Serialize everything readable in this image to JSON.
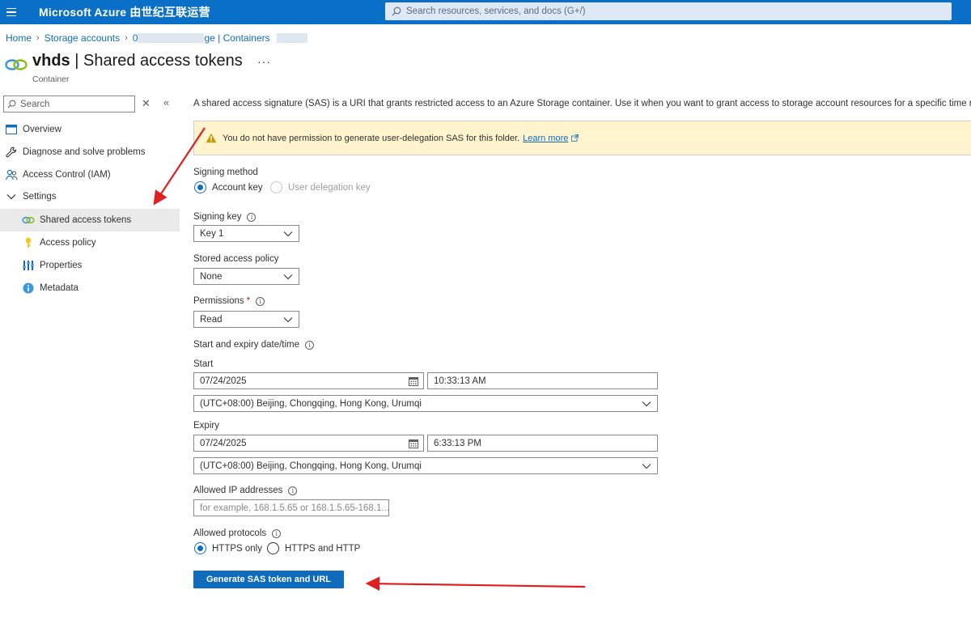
{
  "topbar": {
    "brand": "Microsoft Azure 由世纪互联运营",
    "search_placeholder": "Search resources, services, and docs (G+/)",
    "menu_icon": "hamburger-menu-icon"
  },
  "breadcrumb": {
    "home": "Home",
    "storage_accounts": "Storage accounts",
    "account_prefix": "0",
    "containers": "ge | Containers"
  },
  "page": {
    "title_bold": "vhds",
    "title_rest": " | Shared access tokens",
    "more": "···",
    "subtitle": "Container"
  },
  "nav": {
    "search_placeholder": "Search",
    "items": [
      {
        "label": "Overview",
        "icon": "overview-icon"
      },
      {
        "label": "Diagnose and solve problems",
        "icon": "wrench-icon"
      },
      {
        "label": "Access Control (IAM)",
        "icon": "people-icon"
      },
      {
        "label": "Settings",
        "icon": "chevron-down-icon"
      },
      {
        "label": "Shared access tokens",
        "icon": "link-icon"
      },
      {
        "label": "Access policy",
        "icon": "key-icon"
      },
      {
        "label": "Properties",
        "icon": "properties-icon"
      },
      {
        "label": "Metadata",
        "icon": "info-icon"
      }
    ]
  },
  "main": {
    "description": "A shared access signature (SAS) is a URI that grants restricted access to an Azure Storage container. Use it when you want to grant access to storage account resources for a specific time range",
    "warning_text": "You do not have permission to generate user-delegation SAS for this folder.",
    "warning_link": "Learn more",
    "signing_method_label": "Signing method",
    "signing_method_options": [
      "Account key",
      "User delegation key"
    ],
    "signing_method_selected": "Account key",
    "signing_key_label": "Signing key",
    "signing_key_value": "Key 1",
    "stored_policy_label": "Stored access policy",
    "stored_policy_value": "None",
    "permissions_label": "Permissions",
    "permissions_required": "*",
    "permissions_value": "Read",
    "datetime_label": "Start and expiry date/time",
    "start_label": "Start",
    "start_date": "07/24/2025",
    "start_time": "10:33:13 AM",
    "start_tz": "(UTC+08:00) Beijing, Chongqing, Hong Kong, Urumqi",
    "expiry_label": "Expiry",
    "expiry_date": "07/24/2025",
    "expiry_time": "6:33:13 PM",
    "expiry_tz": "(UTC+08:00) Beijing, Chongqing, Hong Kong, Urumqi",
    "ip_label": "Allowed IP addresses",
    "ip_placeholder": "for example, 168.1.5.65 or 168.1.5.65-168.1....",
    "protocols_label": "Allowed protocols",
    "protocol_options": [
      "HTTPS only",
      "HTTPS and HTTP"
    ],
    "protocol_selected": "HTTPS only",
    "generate_button": "Generate SAS token and URL"
  },
  "colors": {
    "topbar": "#0a6fc7",
    "accent": "#0f6cbd",
    "warning_bg": "#fff4ce",
    "annotation_arrow": "#e02020"
  }
}
